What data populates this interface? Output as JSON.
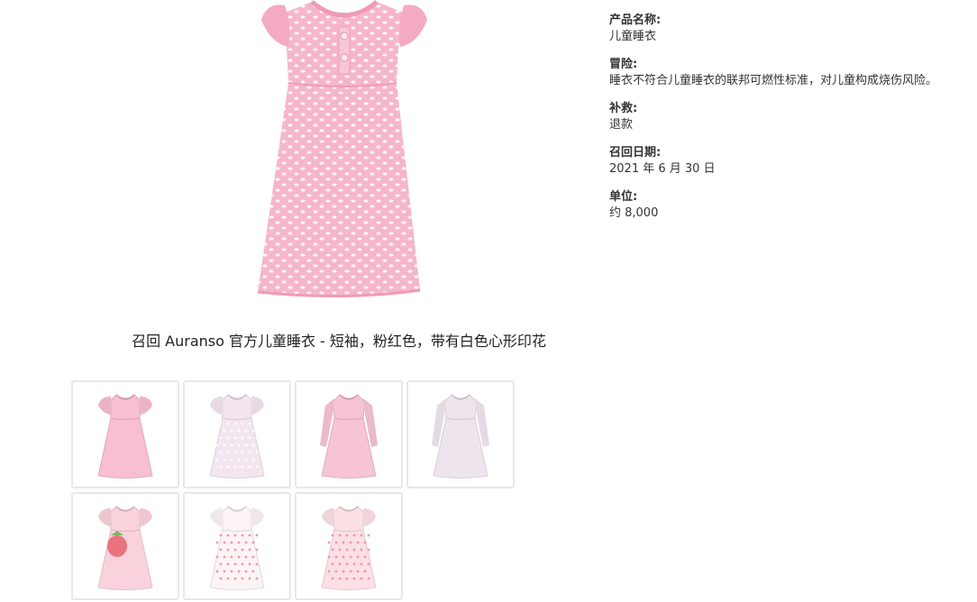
{
  "product": {
    "caption": "召回 Auranso 官方儿童睡衣 - 短袖，粉红色，带有白色心形印花",
    "main_image": {
      "dress_color": "#f5b6cb",
      "dot_color": "#ffffff"
    }
  },
  "thumbnails": [
    {
      "name": "thumb-pink-short-sleeve",
      "color": "#f7bfd1",
      "dot": "#f7bfd1",
      "sleeve": "short",
      "print": "none"
    },
    {
      "name": "thumb-white-lace",
      "color": "#f3e6f0",
      "dot": "#ffffff",
      "sleeve": "short",
      "print": "dots"
    },
    {
      "name": "thumb-pink-long-sleeve",
      "color": "#f6c4d4",
      "dot": "#f6c4d4",
      "sleeve": "long",
      "print": "none"
    },
    {
      "name": "thumb-white-long-sleeve",
      "color": "#eee4ee",
      "dot": "#eee4ee",
      "sleeve": "long",
      "print": "none"
    },
    {
      "name": "thumb-strawberry",
      "color": "#f9d2dc",
      "dot": "#e9747e",
      "sleeve": "short",
      "print": "strawberry"
    },
    {
      "name": "thumb-white-pink-dots",
      "color": "#fbf3f5",
      "dot": "#ef8d9c",
      "sleeve": "short",
      "print": "dots"
    },
    {
      "name": "thumb-light-pink-dots",
      "color": "#fbe0e6",
      "dot": "#ee8f9b",
      "sleeve": "short",
      "print": "dots"
    }
  ],
  "details": [
    {
      "label": "产品名称:",
      "value": "儿童睡衣"
    },
    {
      "label": "冒险:",
      "value": "睡衣不符合儿童睡衣的联邦可燃性标准，对儿童构成烧伤风险。"
    },
    {
      "label": "补救:",
      "value": "退款"
    },
    {
      "label": "召回日期:",
      "value": "2021 年 6 月 30 日"
    },
    {
      "label": "单位:",
      "value": "约 8,000"
    }
  ]
}
